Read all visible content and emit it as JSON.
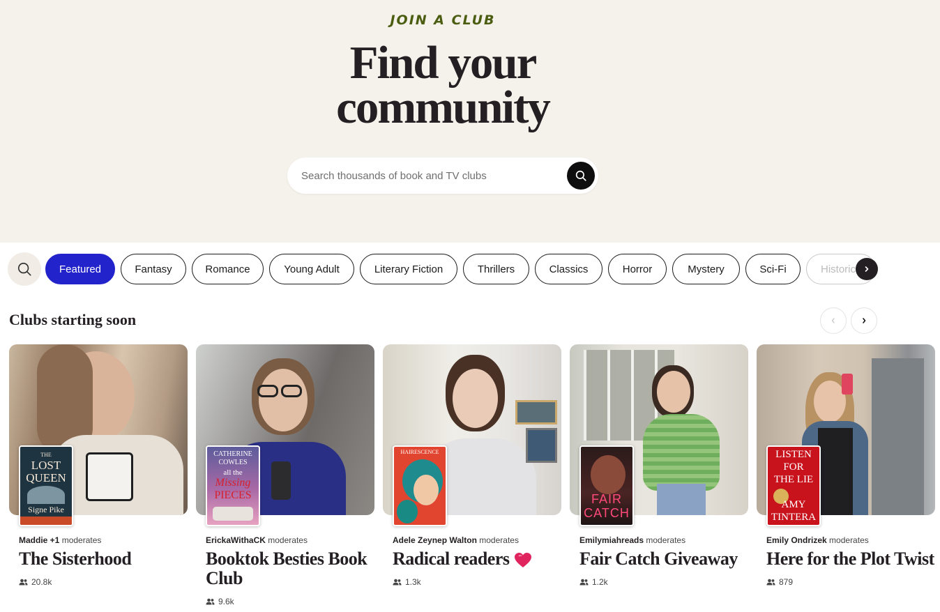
{
  "hero": {
    "eyebrow": "JOIN A CLUB",
    "title_line1": "Find your",
    "title_line2": "community",
    "search_placeholder": "Search thousands of book and TV clubs"
  },
  "categories": [
    "Featured",
    "Fantasy",
    "Romance",
    "Young Adult",
    "Literary Fiction",
    "Thrillers",
    "Classics",
    "Horror",
    "Mystery",
    "Sci-Fi",
    "Historic"
  ],
  "active_category": "Featured",
  "section": {
    "title": "Clubs starting soon"
  },
  "clubs": [
    {
      "moderator": "Maddie +1",
      "moderates_label": "moderates",
      "title": "The Sisterhood",
      "members": "20.8k",
      "book": {
        "line1": "THE",
        "line2": "LOST",
        "line3": "QUEEN",
        "author": "Signe Pike"
      }
    },
    {
      "moderator": "ErickaWithaCK",
      "moderates_label": "moderates",
      "title": "Booktok Besties Book Club",
      "members": "9.6k",
      "book": {
        "line1": "CATHERINE",
        "line2": "COWLES",
        "line3": "all the",
        "line4": "Missing",
        "line5": "PIECES"
      }
    },
    {
      "moderator": "Adele Zeynep Walton",
      "moderates_label": "moderates",
      "title": "Radical readers",
      "members": "1.3k",
      "book": {
        "line1": "HAIRESCENCE"
      }
    },
    {
      "moderator": "Emilymiahreads",
      "moderates_label": "moderates",
      "title": "Fair Catch Giveaway",
      "members": "1.2k",
      "book": {
        "line1": "FAIR",
        "line2": "CATCH"
      }
    },
    {
      "moderator": "Emily Ondrizek",
      "moderates_label": "moderates",
      "title": "Here for the Plot Twist",
      "members": "879",
      "book": {
        "line1": "LISTEN",
        "line2": "FOR",
        "line3": "THE LIE",
        "line4": "AMY",
        "line5": "TINTERA"
      }
    }
  ],
  "colors": {
    "accent": "#2323cc",
    "hero_bg": "#f5f2ec",
    "eyebrow": "#4b5d10",
    "heart": "#e0245e"
  }
}
